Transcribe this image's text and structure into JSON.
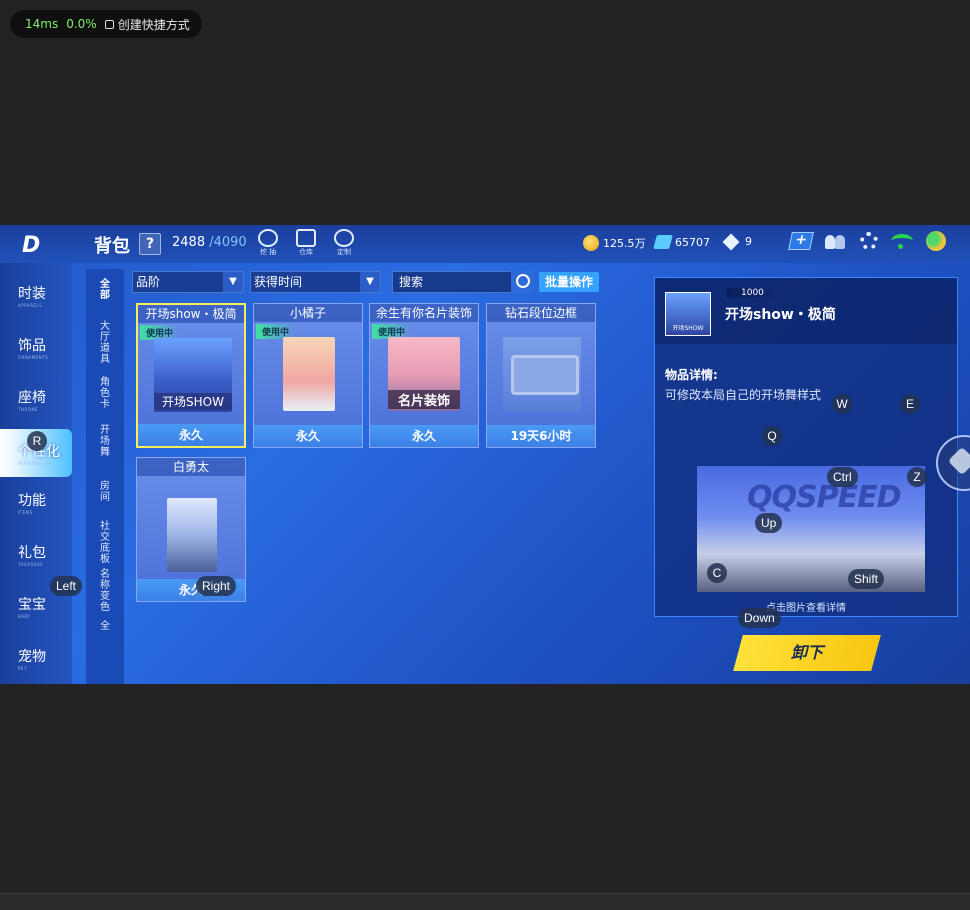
{
  "perf": {
    "latency": "14ms",
    "cpu": "0.0%",
    "shortcut": "创建快捷方式"
  },
  "header": {
    "logo": "D",
    "title": "背包",
    "help": "?",
    "capacity_used": "2488",
    "capacity_max": "/4090",
    "icons": [
      {
        "label": "挖 抽",
        "icon": "dig-icon"
      },
      {
        "label": "仓库",
        "icon": "warehouse-icon"
      },
      {
        "label": "定制",
        "icon": "custom-icon"
      }
    ],
    "coins": "125.5万",
    "tickets": "65707",
    "diamonds": "9"
  },
  "left_nav": [
    {
      "cn": "时装",
      "en": "APPARELS"
    },
    {
      "cn": "饰品",
      "en": "ORNAMENTS"
    },
    {
      "cn": "座椅",
      "en": "THRONE"
    },
    {
      "cn": "个性化",
      "en": "PERSONALIZE",
      "active": true
    },
    {
      "cn": "功能",
      "en": "ITEMS"
    },
    {
      "cn": "礼包",
      "en": "TREASURE"
    },
    {
      "cn": "宝宝",
      "en": "BABY"
    },
    {
      "cn": "宠物",
      "en": "PET"
    }
  ],
  "sub_nav": [
    "全部",
    "大厅道具",
    "角色卡",
    "开场舞",
    "房间",
    "社交底板",
    "名称变色",
    "全"
  ],
  "filters": {
    "rank": "品阶",
    "time": "获得时间",
    "search_placeholder": "搜索",
    "batch": "批量操作"
  },
  "items": [
    {
      "title": "开场show・极简",
      "badge": "使用中",
      "pic_label": "开场SHOW",
      "duration": "永久"
    },
    {
      "title": "小橘子",
      "badge": "使用中",
      "pic_label": "",
      "duration": "永久"
    },
    {
      "title": "余生有你名片装饰",
      "badge": "使用中",
      "pic_label": "名片装饰",
      "duration": "永久"
    },
    {
      "title": "钻石段位边框",
      "badge": "",
      "pic_label": "",
      "duration": "19天6小时"
    },
    {
      "title": "白勇太",
      "badge": "",
      "pic_label": "",
      "duration": "永久"
    }
  ],
  "detail": {
    "score": "1000",
    "thumb_label": "开场SHOW",
    "name": "开场show・极简",
    "section": "物品详情:",
    "description": "可修改本局自己的开场舞样式",
    "preview_brand": "QQSPEED",
    "tip": "点击图片查看详情",
    "unequip": "卸下"
  },
  "key_overlays": {
    "r": "R",
    "left": "Left",
    "right": "Right",
    "w": "W",
    "e": "E",
    "q": "Q",
    "ctrl": "Ctrl",
    "z": "Z",
    "up": "Up",
    "c": "C",
    "shift": "Shift",
    "down": "Down"
  }
}
